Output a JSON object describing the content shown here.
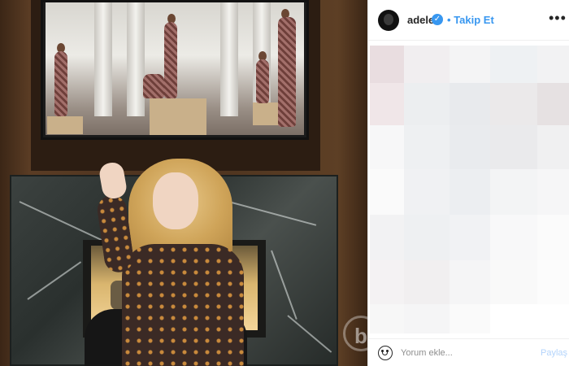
{
  "post": {
    "username": "adele",
    "follow_label": "Takip Et",
    "follow_separator": "•",
    "more_label": "•••",
    "verified_mark": "✓"
  },
  "comment_box": {
    "placeholder": "Yorum ekle...",
    "share_label": "Paylaş"
  },
  "colors": {
    "accent": "#3897f0",
    "share_disabled": "#b3d4fc"
  },
  "icons": [
    "verified-badge-icon",
    "more-options-icon",
    "emoji-icon"
  ]
}
